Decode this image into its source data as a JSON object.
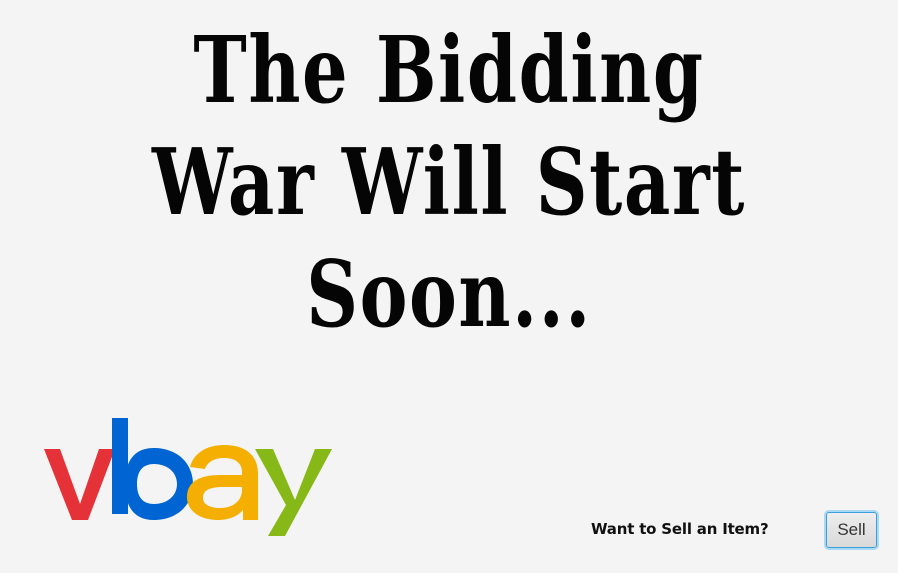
{
  "headline": {
    "line1": "The Bidding",
    "line2": "War Will Start",
    "line3": "Soon..."
  },
  "logo": {
    "text": "vbay",
    "letters": [
      "v",
      "b",
      "a",
      "y"
    ],
    "colors": [
      "#e53238",
      "#0064d2",
      "#f5af02",
      "#86b817"
    ]
  },
  "sell": {
    "prompt": "Want to Sell an Item?",
    "button_label": "Sell"
  },
  "colors": {
    "background": "#f4f4f4",
    "button_focus": "#3d9fd9"
  }
}
